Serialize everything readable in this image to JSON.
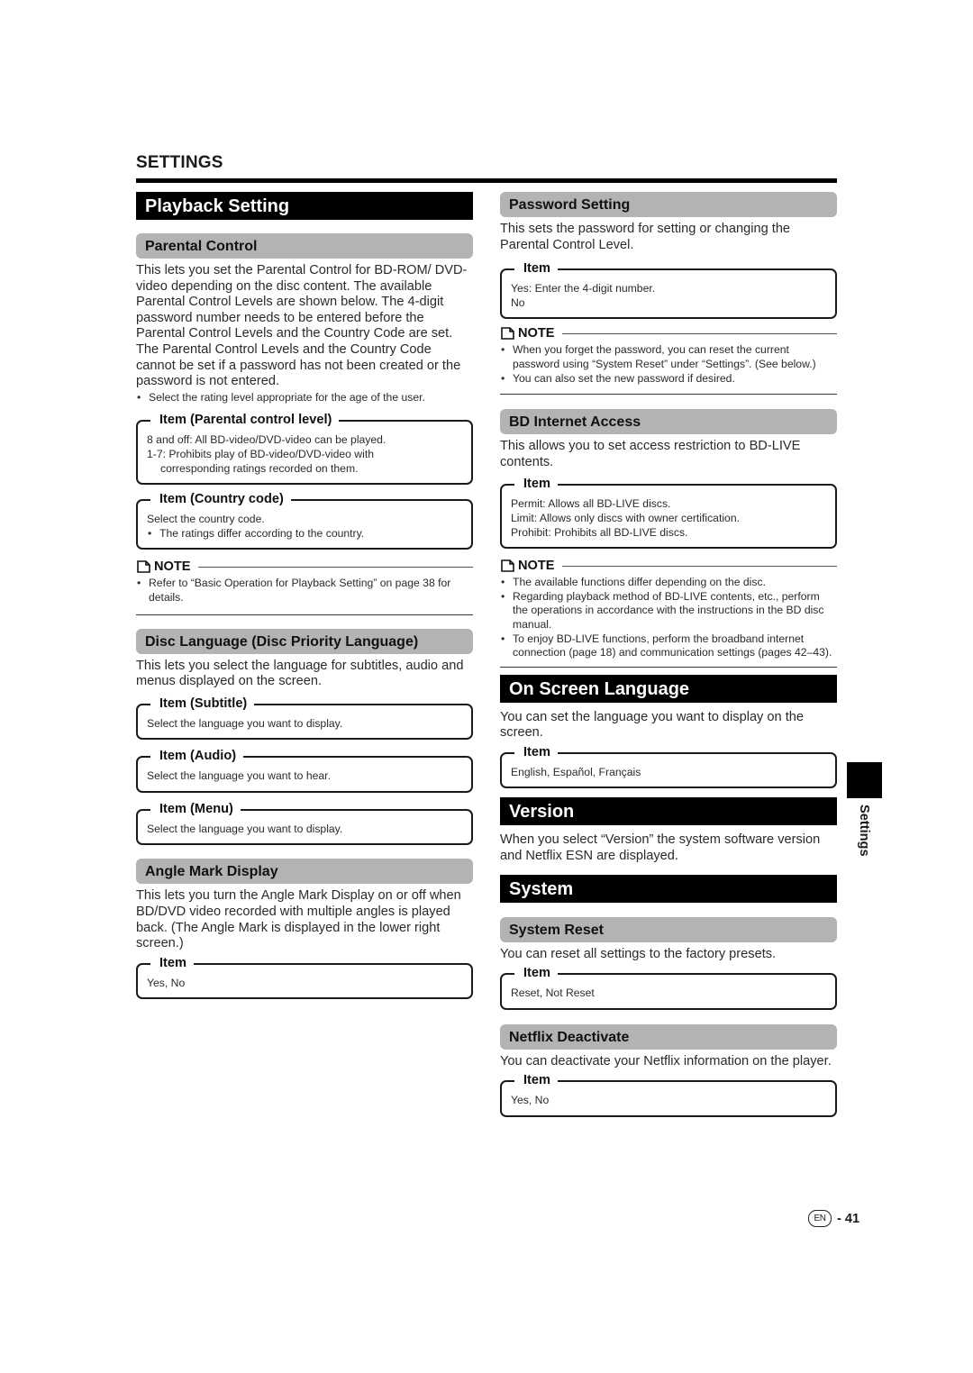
{
  "header": {
    "section": "SETTINGS"
  },
  "playback": {
    "title": "Playback Setting",
    "parental": {
      "title": "Parental Control",
      "text": "This lets you set the Parental Control for BD-ROM/ DVD-video depending on the disc content. The available Parental Control Levels are shown below. The 4-digit password number needs to be entered before the Parental Control Levels and the Country Code are set. The Parental Control Levels and the Country Code cannot be set if a password has not been created or the password is not entered.",
      "bullet": "Select the rating level appropriate for the age of the user.",
      "level_box": {
        "title": "Item (Parental control level)",
        "line1": "8 and off: All BD-video/DVD-video can be played.",
        "line2": "1-7: Prohibits play of BD-video/DVD-video with",
        "line3": "corresponding ratings recorded on them."
      },
      "country_box": {
        "title": "Item (Country code)",
        "line1": "Select the country code.",
        "bullet": "The ratings differ according to the country."
      },
      "note": {
        "label": "NOTE",
        "bullets": [
          "Refer to “Basic Operation for Playback Setting” on page 38 for details."
        ]
      }
    },
    "disc_language": {
      "title": "Disc Language (Disc Priority Language)",
      "text": "This lets you select the language for subtitles, audio and menus displayed on the screen.",
      "boxes": [
        {
          "title": "Item (Subtitle)",
          "text": "Select the language you want to display."
        },
        {
          "title": "Item (Audio)",
          "text": "Select the language you want to hear."
        },
        {
          "title": "Item (Menu)",
          "text": "Select the language you want to display."
        }
      ]
    },
    "angle_mark": {
      "title": "Angle Mark Display",
      "text": "This lets you turn the Angle Mark Display on or off when BD/DVD video recorded with multiple angles is played back. (The Angle Mark is displayed in the lower right screen.)",
      "box": {
        "title": "Item",
        "text": "Yes, No"
      }
    },
    "password": {
      "title": "Password Setting",
      "text": "This sets the password for setting or changing the Parental Control Level.",
      "box": {
        "title": "Item",
        "line1": "Yes: Enter the 4-digit number.",
        "line2": "No"
      },
      "note": {
        "label": "NOTE",
        "bullets": [
          "When you forget the password, you can reset the current password using “System Reset” under “Settings”. (See below.)",
          "You can also set the new password if desired."
        ]
      }
    },
    "bd_internet": {
      "title": "BD Internet Access",
      "text": "This allows you to set access restriction to BD-LIVE contents.",
      "box": {
        "title": "Item",
        "line1": "Permit: Allows all BD-LIVE discs.",
        "line2": "Limit: Allows only discs with owner certification.",
        "line3": "Prohibit: Prohibits all BD-LIVE discs."
      },
      "note": {
        "label": "NOTE",
        "bullets": [
          "The available functions differ depending on the disc.",
          "Regarding playback method of BD-LIVE contents, etc., perform the operations in accordance with the instructions in the BD disc manual.",
          "To enjoy BD-LIVE functions, perform the broadband internet connection (page 18) and communication settings (pages 42–43)."
        ]
      }
    }
  },
  "on_screen_language": {
    "title": "On Screen Language",
    "text": "You can set the language you want to display on the screen.",
    "box": {
      "title": "Item",
      "text": "English, Español, Français"
    }
  },
  "version": {
    "title": "Version",
    "text": "When you select “Version” the system software version and Netflix ESN are displayed."
  },
  "system": {
    "title": "System",
    "reset": {
      "title": "System Reset",
      "text": "You can reset all settings to the factory presets.",
      "box": {
        "title": "Item",
        "text": "Reset, Not Reset"
      }
    },
    "netflix": {
      "title": "Netflix Deactivate",
      "text": "You can deactivate your Netflix information on the player.",
      "box": {
        "title": "Item",
        "text": "Yes, No"
      }
    }
  },
  "side_tab": {
    "label": "Settings"
  },
  "footer": {
    "lang_badge": "EN",
    "page_number": "- 41"
  }
}
